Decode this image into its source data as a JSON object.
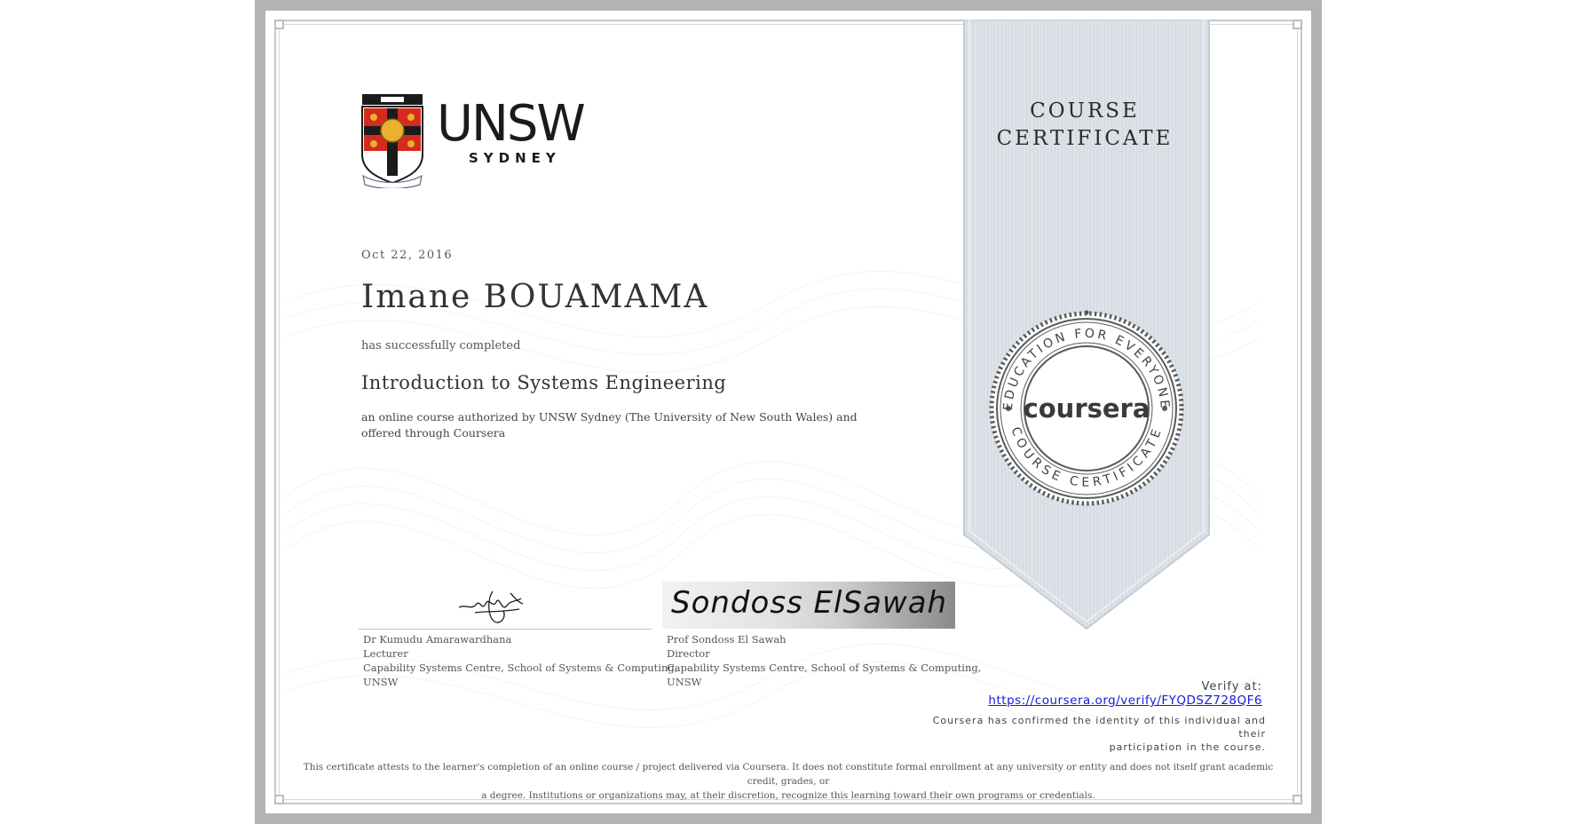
{
  "institution": {
    "name": "UNSW",
    "subtitle": "SYDNEY",
    "crest_motto": "MANU ET MENTE",
    "crest_banner": "SCIENTIA"
  },
  "ribbon": {
    "title_line1": "COURSE",
    "title_line2": "CERTIFICATE"
  },
  "seal": {
    "top_text": "EDUCATION FOR EVERYONE",
    "center_text": "coursera",
    "bottom_text": "COURSE CERTIFICATE"
  },
  "certificate": {
    "date": "Oct 22, 2016",
    "recipient": "Imane BOUAMAMA",
    "completed_text": "has successfully completed",
    "course_title": "Introduction to Systems Engineering",
    "description": "an online course authorized by UNSW Sydney (The University of New South Wales) and offered through Coursera"
  },
  "signers": [
    {
      "name": "Dr Kumudu Amarawardhana",
      "role": "Lecturer",
      "org_line1": "Capability Systems Centre, School of Systems & Computing,",
      "org_line2": "UNSW"
    },
    {
      "name": "Prof Sondoss El Sawah",
      "role": "Director",
      "org_line1": "Capability Systems Centre, School of Systems & Computing,",
      "org_line2": "UNSW",
      "signature_text": "Sondoss ElSawah"
    }
  ],
  "verify": {
    "label": "Verify at:",
    "url": "https://coursera.org/verify/FYQDSZ728QF6",
    "confirm_line1": "Coursera has confirmed the identity of this individual and their",
    "confirm_line2": "participation in the course."
  },
  "footer": {
    "line1": "This certificate attests to the learner's completion of an online course / project delivered via Coursera. It does not constitute formal enrollment at any university or entity and does not itself grant academic credit, grades, or",
    "line2": "a degree. Institutions or organizations may, at their discretion, recognize this learning toward their own programs or credentials."
  },
  "colors": {
    "frame_grey": "#b3b3b3",
    "ribbon_fill": "#dde2e8",
    "crest_red": "#d52b1e",
    "crest_gold": "#e8b22e",
    "link_blue": "#1a1ad6"
  }
}
